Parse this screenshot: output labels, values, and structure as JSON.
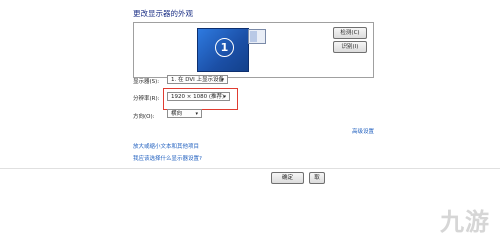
{
  "title": "更改显示器的外观",
  "preview": {
    "monitor_number": "1"
  },
  "buttons": {
    "detect": "检测(C)",
    "identify": "识别(I)",
    "ok": "确定",
    "cancel": "取"
  },
  "fields": {
    "display_label": "显示器(S):",
    "display_value": "1. 在 DVI 上显示设备",
    "resolution_label": "分辨率(R):",
    "resolution_value": "1920 × 1080 (推荐)",
    "orientation_label": "方向(O):",
    "orientation_value": "横向"
  },
  "links": {
    "advanced": "高级设置",
    "text_size": "放大或缩小文本和其他项目",
    "which_settings": "我应该选择什么显示器设置?"
  },
  "watermark": "九游",
  "colors": {
    "highlight": "#e03c31",
    "link": "#1f5fbf",
    "title": "#1e3287"
  }
}
